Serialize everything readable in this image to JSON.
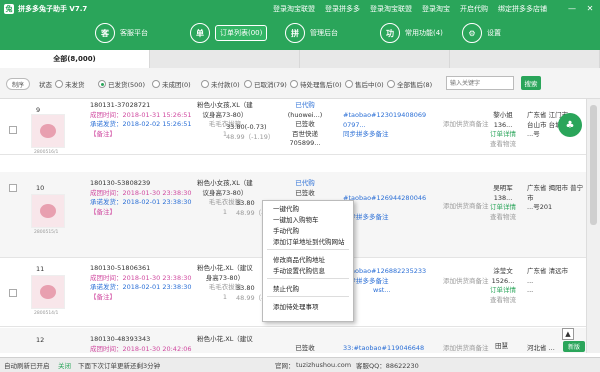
{
  "app": {
    "title": "拼多多兔子助手 V7.7"
  },
  "titlebar": {
    "links": [
      "登录淘宝联盟",
      "登录拼多多",
      "登录淘宝联盟",
      "登录淘宝",
      "开启代购",
      "绑定拼多多店铺"
    ]
  },
  "nav": [
    {
      "icon": "客",
      "label": "客服平台"
    },
    {
      "icon": "单",
      "label": "订单列表(00)"
    },
    {
      "icon": "拼",
      "label": "管理后台"
    },
    {
      "icon": "功",
      "label": "常用功能(4)"
    },
    {
      "icon": "⚙",
      "label": "设置"
    }
  ],
  "tabs": [
    "全部(8,000)",
    "",
    "",
    ""
  ],
  "filter": {
    "chip": "制序",
    "status_label": "状态",
    "options": [
      "未发货",
      "已发货(500)",
      "未成团(0)",
      "未付款(0)",
      "已取消(79)",
      "待处理售后(0)",
      "售后中(0)",
      "全部售后(8)"
    ],
    "selected": 1,
    "search_placeholder": "输入关键字",
    "search_button": "搜索"
  },
  "rows": [
    {
      "idx": "9",
      "date": "2800516/1",
      "order": "180131-37028721",
      "created": "成团时间：2018-01-31 15:26:51",
      "ship": "承诺发货：2018-02-02 15:26:51",
      "note": "【备注】",
      "product": [
        "粉色小女孩,XL（建",
        "议身高73-80）",
        "毛毛衣拔箍",
        "1"
      ],
      "amount": "33.80(-0.73)",
      "fee": "48.99（-1.19）",
      "agent": [
        "已代购",
        "(huowei...)",
        "已签收",
        "百世快递",
        "705899..."
      ],
      "taobao": [
        "#taobao#123019408069",
        "0797..."
      ],
      "sync": "同步拼多多备注",
      "addnote": "添加供货商备注",
      "buyer": [
        "黎小姐",
        "136...",
        "订单详情",
        "查看物流"
      ],
      "addr": [
        "广东省 江门市",
        "台山市 台城...",
        "...号"
      ]
    },
    {
      "idx": "10",
      "date": "2800515/1",
      "order": "180130-53808239",
      "created": "成团时间：2018-01-30 23:38:30",
      "ship": "承诺发货：2018-02-01 23:38:30",
      "note": "【备注】",
      "product": [
        "粉色小女孩,XL（建",
        "议身高73-80）",
        "毛毛衣拔箍",
        "1"
      ],
      "amount": "33.80",
      "fee": "48.99（-1.19）",
      "agent": [
        "已代购",
        "",
        "已签收",
        "",
        ""
      ],
      "taobao": [
        "#taobao#126944280046",
        "..."
      ],
      "sync": "同步拼多多备注",
      "addnote": "添加供货商备注",
      "buyer": [
        "吴明军",
        "138...",
        "订单详情",
        "查看物流"
      ],
      "addr": [
        "广东省 揭阳市 普宁",
        "市",
        "...号201"
      ]
    },
    {
      "idx": "11",
      "date": "2800514/1",
      "order": "180130-51806361",
      "created": "成团时间：2018-01-30 23:38:30",
      "ship": "承诺发货：2018-02-01 23:38:30",
      "note": "【备注】",
      "product": [
        "粉色小花,XL（建议",
        "身高73-80）",
        "毛毛衣拔箍",
        "1"
      ],
      "amount": "33.80",
      "fee": "48.99（-1.19）",
      "agent": [
        "",
        "",
        "",
        "",
        ""
      ],
      "taobao": [
        "#taobao#126882235233",
        "wst..."
      ],
      "sync": "同步拼多多备注",
      "addnote": "添加供货商备注",
      "buyer": [
        "涂莹文",
        "1526...",
        "订单详情",
        "查看物流"
      ],
      "addr": [
        "广东省 清远市",
        "...",
        "..."
      ]
    },
    {
      "idx": "12",
      "date": "2800513/1",
      "order": "180130-48393343",
      "created": "成团时间：2018-01-30 20:42:06",
      "ship": "",
      "note": "",
      "product": [
        "粉色小花,XL（建议",
        "",
        ""
      ],
      "amount": "",
      "fee": "",
      "agent": [
        "已签收",
        "",
        "",
        "",
        ""
      ],
      "taobao": [
        "33:#taobao#119046648",
        ""
      ],
      "sync": "",
      "addnote": "添加供货商备注",
      "buyer": [
        "田慧",
        "",
        "",
        ""
      ],
      "addr": [
        "河北省 ...",
        "",
        ""
      ]
    }
  ],
  "context_menu": {
    "groups": [
      [
        "一键代购",
        "一键加入购物车",
        "手动代购",
        "添加订单地址到代购网站"
      ],
      [
        "修改商品代购地址",
        "手动设置代购信息"
      ],
      [
        "禁止代购"
      ],
      [
        "添加待处理事项"
      ]
    ]
  },
  "fab": "♣",
  "up_button": "▲",
  "new_button": "新版",
  "status": {
    "auto_fetch": "自动刷新已开启",
    "off": "关闭",
    "next": "下面下次订单更新还剩3分钟",
    "site_label": "官网：",
    "site": "tuzizhushou.com",
    "qq": "客服QQ：88622230"
  }
}
